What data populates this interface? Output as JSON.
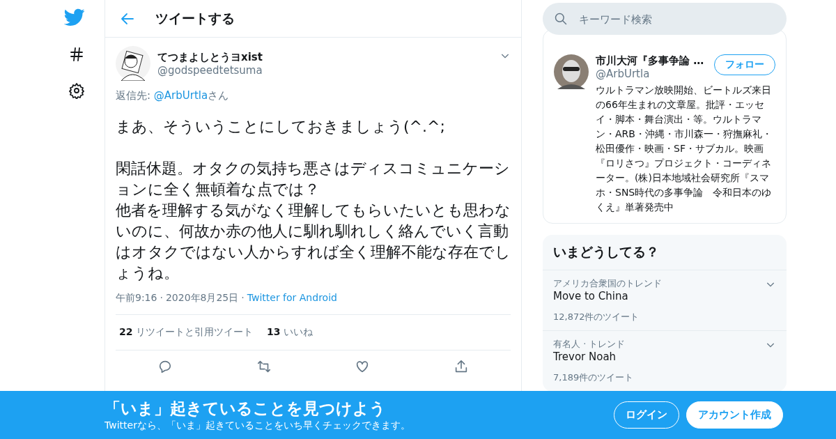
{
  "header": {
    "title": "ツイートする"
  },
  "tweet": {
    "name": "てつまよしとうヨxist",
    "handle": "@godspeedtetsuma",
    "reply_prefix": "返信先: ",
    "reply_to": "@ArbUrtla",
    "reply_suffix": "さん",
    "paragraphs": [
      "まあ、そういうことにしておきましょう(^.^;",
      "閑話休題。オタクの気持ち悪さはディスコミュニケーションに全く無頓着な点では？",
      "他者を理解する気がなく理解してもらいたいとも思わないのに、何故か赤の他人に馴れ馴れしく絡んでいく言動はオタクではない人からすれば全く理解不能な存在でしょうね。"
    ],
    "time": "午前9:16",
    "separator_1": "·",
    "separator_2": "·",
    "date": "2020年8月25日",
    "source": "Twitter for Android",
    "retweets": "22",
    "retweets_label": "リツイートと引用ツイート",
    "likes": "13",
    "likes_label": "いいね"
  },
  "search": {
    "placeholder": "キーワード検索"
  },
  "profile": {
    "name": "市川大河『多事争論 …",
    "handle": "@ArbUrtla",
    "follow": "フォロー",
    "bio": "ウルトラマン放映開始、ビートルズ来日の66年生まれの文章屋。批評・エッセイ・脚本・舞台演出・等。ウルトラマン・ARB・沖縄・市川森一・狩撫麻礼・松田優作・映画・SF・サブカル。映画『ロリさつ』プロジェクト・コーディネーター。(株)日本地域社会研究所『スマホ・SNS時代の多事争論　令和日本のゆくえ』単著発売中"
  },
  "trends": {
    "title": "いまどうしてる？",
    "items": [
      {
        "context": "アメリカ合衆国のトレンド",
        "name": "Move to China",
        "count": "12,872件のツイート"
      },
      {
        "context": "有名人 · トレンド",
        "name": "Trevor Noah",
        "count": "7,189件のツイート"
      }
    ]
  },
  "banner": {
    "title": "「いま」起きていることを見つけよう",
    "subtitle": "Twitterなら、「いま」起きていることをいち早くチェックできます。",
    "login": "ログイン",
    "signup": "アカウント作成"
  }
}
